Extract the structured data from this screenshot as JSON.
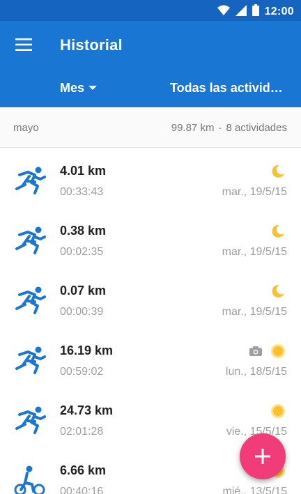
{
  "status_bar": {
    "time": "12:00",
    "icons": [
      "wifi-icon",
      "signal-icon",
      "battery-icon"
    ]
  },
  "app_bar": {
    "title": "Historial",
    "menu_icon": "menu-icon",
    "filter_month_label": "Mes",
    "filter_activity_label": "Todas las activida…",
    "color": "#1976d2",
    "status_color": "#1565c0"
  },
  "section": {
    "month": "mayo",
    "total_distance": "99.87 km",
    "separator": "·",
    "activity_count": "8 actividades"
  },
  "activities": [
    {
      "sport": "running-icon",
      "distance": "4.01 km",
      "duration": "00:33:43",
      "date": "mar., 19/5/15",
      "weather": "moon-icon",
      "photo": false
    },
    {
      "sport": "running-icon",
      "distance": "0.38 km",
      "duration": "00:02:35",
      "date": "mar., 19/5/15",
      "weather": "moon-icon",
      "photo": false
    },
    {
      "sport": "running-icon",
      "distance": "0.07 km",
      "duration": "00:00:39",
      "date": "mar., 19/5/15",
      "weather": "moon-icon",
      "photo": false
    },
    {
      "sport": "running-icon",
      "distance": "16.19 km",
      "duration": "00:59:02",
      "date": "lun., 18/5/15",
      "weather": "sun-icon",
      "photo": true
    },
    {
      "sport": "running-icon",
      "distance": "24.73 km",
      "duration": "02:01:28",
      "date": "vie., 15/5/15",
      "weather": "sun-icon",
      "photo": false
    },
    {
      "sport": "cycling-icon",
      "distance": "6.66 km",
      "duration": "00:40:16",
      "date": "mié., 13/5/15",
      "weather": "sun-icon",
      "photo": false
    }
  ],
  "fab": {
    "icon": "add-icon",
    "color": "#f03c78"
  },
  "colors": {
    "sport_icon": "#1976d2",
    "weather": "#fbc02d",
    "secondary_text": "#9e9e9e"
  }
}
